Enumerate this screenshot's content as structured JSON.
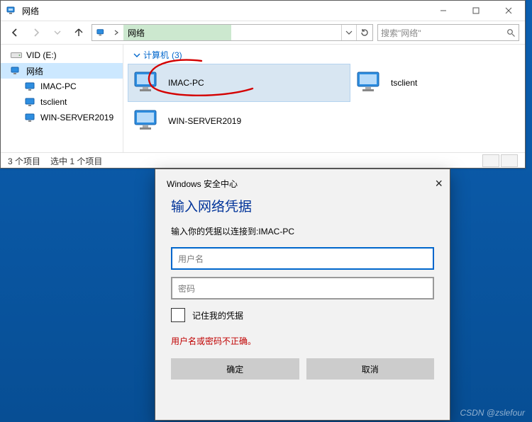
{
  "explorer": {
    "title": "网络",
    "address": {
      "current": "网络"
    },
    "search": {
      "placeholder": "搜索\"网络\""
    },
    "nav": {
      "drive": "VID (E:)",
      "network": "网络",
      "children": [
        "IMAC-PC",
        "tsclient",
        "WIN-SERVER2019"
      ]
    },
    "group": {
      "label": "计算机",
      "count": "(3)"
    },
    "items": [
      {
        "name": "IMAC-PC",
        "selected": true
      },
      {
        "name": "tsclient",
        "selected": false
      },
      {
        "name": "WIN-SERVER2019",
        "selected": false
      }
    ],
    "status": {
      "count": "3 个项目",
      "selection": "选中 1 个项目"
    }
  },
  "dialog": {
    "windowTitle": "Windows 安全中心",
    "heading": "输入网络凭据",
    "sub": "输入你的凭据以连接到:IMAC-PC",
    "userPlaceholder": "用户名",
    "passPlaceholder": "密码",
    "remember": "记住我的凭据",
    "error": "用户名或密码不正确。",
    "ok": "确定",
    "cancel": "取消"
  },
  "watermark": "CSDN @zslefour"
}
